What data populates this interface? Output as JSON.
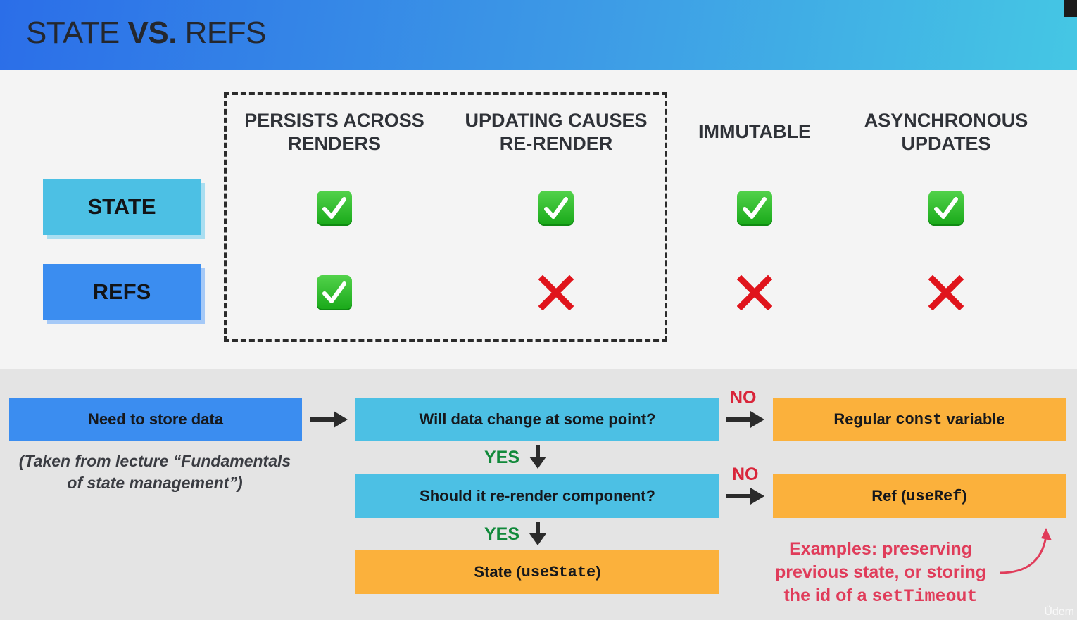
{
  "header": {
    "title_normal_1": "STATE ",
    "title_bold": "VS.",
    "title_normal_2": " REFS"
  },
  "table": {
    "columns": [
      "PERSISTS ACROSS RENDERS",
      "UPDATING CAUSES RE-RENDER",
      "IMMUTABLE",
      "ASYNCHRONOUS UPDATES"
    ],
    "column_lines": [
      [
        "PERSISTS ACROSS",
        "RENDERS"
      ],
      [
        "UPDATING CAUSES",
        "RE-RENDER"
      ],
      [
        "IMMUTABLE"
      ],
      [
        "ASYNCHRONOUS",
        "UPDATES"
      ]
    ],
    "rows": [
      {
        "label": "STATE",
        "values": [
          true,
          true,
          true,
          true
        ]
      },
      {
        "label": "REFS",
        "values": [
          true,
          false,
          false,
          false
        ]
      }
    ]
  },
  "flow": {
    "need_store": "Need to store data",
    "q_change": "Will data change at some point?",
    "q_rerender": "Should it re-render component?",
    "regular_pre": "Regular ",
    "regular_code": "const",
    "regular_post": " variable",
    "ref_pre": "Ref (",
    "ref_code": "useRef",
    "ref_post": ")",
    "state_pre": "State (",
    "state_code": "useState",
    "state_post": ")",
    "yes_label": "YES",
    "no_label": "NO",
    "note_line1": "(Taken from lecture “Fundamentals",
    "note_line2": "of state management”)",
    "example_line1": "Examples: preserving",
    "example_line2": "previous state, or storing",
    "example_line3_pre": "the id of a ",
    "example_line3_code": "setTimeout"
  },
  "watermark": "Üdem",
  "colors": {
    "check_green": "#1fae1f",
    "cross_red": "#e0141c",
    "yes_green": "#11893a",
    "no_red": "#d9253a",
    "example_pink": "#e03c5a",
    "box_blue": "#3b8df0",
    "box_cyan": "#4cc0e4",
    "box_orange": "#fbb13c"
  },
  "icons": {
    "check": "check-mark-icon",
    "cross": "cross-mark-icon",
    "arrow": "arrow-icon"
  }
}
